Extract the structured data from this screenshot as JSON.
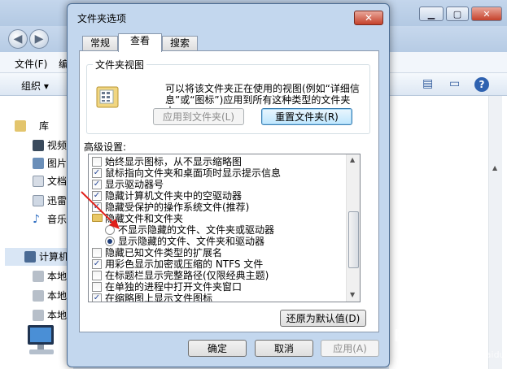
{
  "explorer": {
    "menu_file": "文件(F)",
    "menu_edit": "编",
    "organize": "组织 ▾",
    "sidebar": {
      "library": "库",
      "video": "视频",
      "pictures": "图片",
      "documents": "文档",
      "xunlei": "迅雷",
      "music": "音乐",
      "computer": "计算机",
      "local1": "本地",
      "local2": "本地",
      "local3": "本地"
    }
  },
  "dialog": {
    "title": "文件夹选项",
    "close": "✕",
    "tabs": [
      "常规",
      "查看",
      "搜索"
    ],
    "folder_view": {
      "legend": "文件夹视图",
      "description": "可以将该文件夹正在使用的视图(例如“详细信息”或“图标”)应用到所有这种类型的文件夹中。",
      "apply_button": "应用到文件夹(L)",
      "reset_button": "重置文件夹(R)"
    },
    "advanced_label": "高级设置:",
    "settings": [
      {
        "type": "checkbox",
        "checked": false,
        "label": "始终显示图标，从不显示缩略图"
      },
      {
        "type": "checkbox",
        "checked": true,
        "label": "鼠标指向文件夹和桌面项时显示提示信息"
      },
      {
        "type": "checkbox",
        "checked": true,
        "label": "显示驱动器号"
      },
      {
        "type": "checkbox",
        "checked": true,
        "label": "隐藏计算机文件夹中的空驱动器"
      },
      {
        "type": "checkbox",
        "checked": true,
        "label": "隐藏受保护的操作系统文件(推荐)"
      },
      {
        "type": "folder",
        "label": "隐藏文件和文件夹"
      },
      {
        "type": "radio",
        "checked": false,
        "label": "不显示隐藏的文件、文件夹或驱动器"
      },
      {
        "type": "radio",
        "checked": true,
        "label": "显示隐藏的文件、文件夹和驱动器"
      },
      {
        "type": "checkbox",
        "checked": false,
        "label": "隐藏已知文件类型的扩展名"
      },
      {
        "type": "checkbox",
        "checked": true,
        "label": "用彩色显示加密或压缩的 NTFS 文件"
      },
      {
        "type": "checkbox",
        "checked": false,
        "label": "在标题栏显示完整路径(仅限经典主题)"
      },
      {
        "type": "checkbox",
        "checked": false,
        "label": "在单独的进程中打开文件夹窗口"
      },
      {
        "type": "checkbox",
        "checked": true,
        "label": "在缩略图上显示文件图标"
      }
    ],
    "restore_defaults": "还原为默认值(D)",
    "ok": "确定",
    "cancel": "取消",
    "apply": "应用(A)"
  },
  "watermark": {
    "brand": "Bai 经验",
    "sub": "jingyan.baidu.com"
  },
  "colors": {
    "dialog_frame": "#c3d7ee",
    "arrow": "#e0201a",
    "checkmark": "#2a4a9a"
  }
}
